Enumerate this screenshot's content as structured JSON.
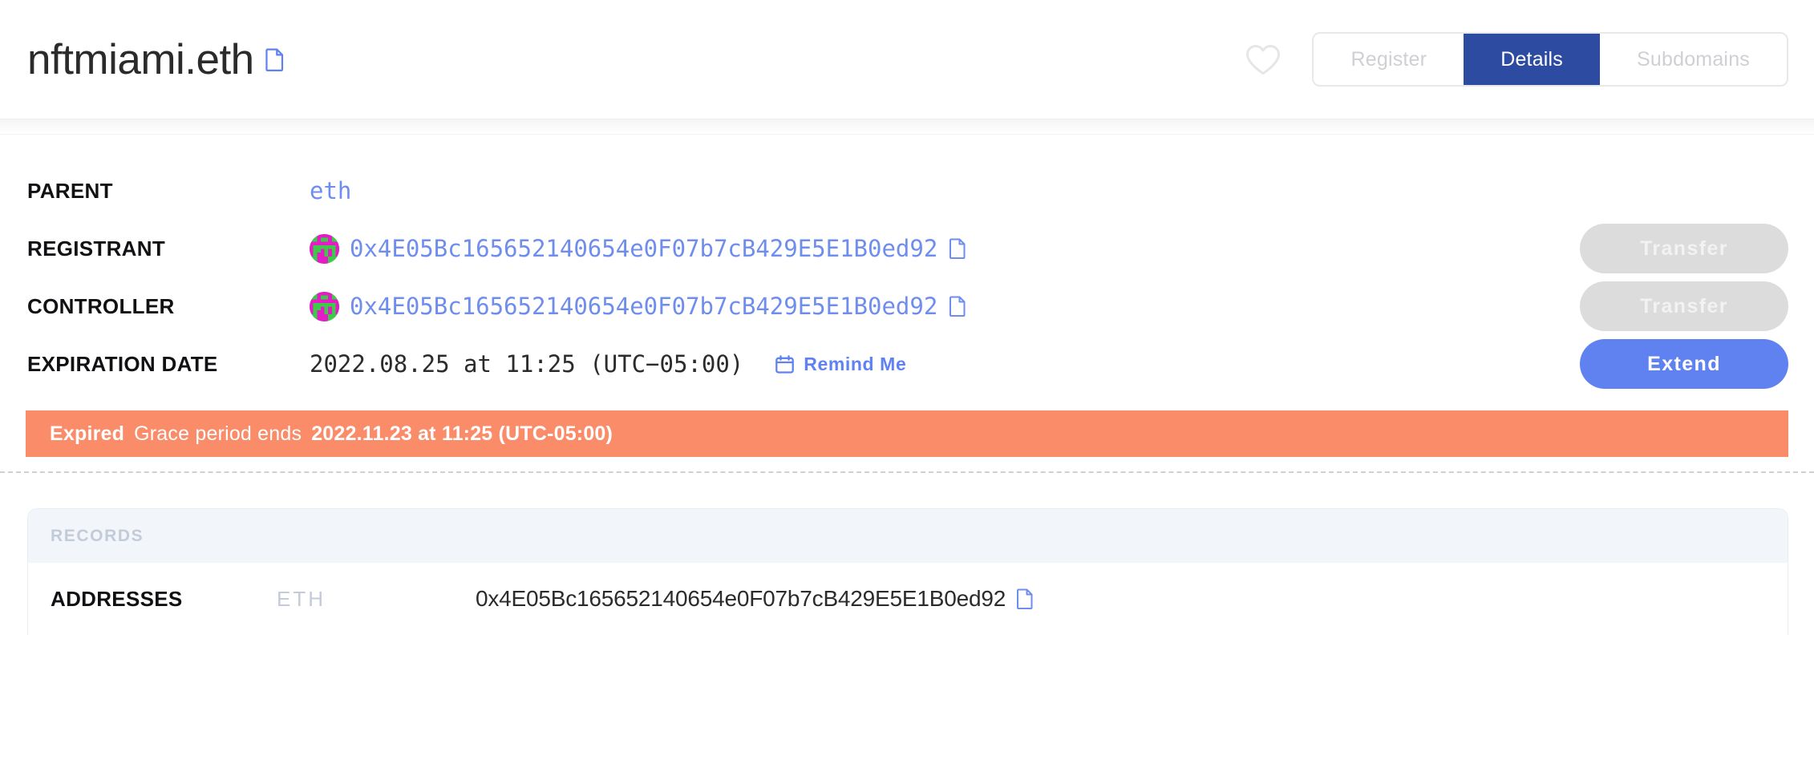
{
  "header": {
    "domain_title": "nftmiami.eth",
    "copy_icon": "copy-document-icon",
    "favorite_icon": "heart-icon",
    "tabs": [
      {
        "label": "Register",
        "active": false
      },
      {
        "label": "Details",
        "active": true
      },
      {
        "label": "Subdomains",
        "active": false
      }
    ]
  },
  "details": {
    "rows": [
      {
        "label": "PARENT",
        "value": "eth",
        "has_avatar": false,
        "has_copy": false,
        "action": null
      },
      {
        "label": "REGISTRANT",
        "value": "0x4E05Bc165652140654e0F07b7cB429E5E1B0ed92",
        "has_avatar": true,
        "has_copy": true,
        "action": "Transfer"
      },
      {
        "label": "CONTROLLER",
        "value": "0x4E05Bc165652140654e0F07b7cB429E5E1B0ed92",
        "has_avatar": true,
        "has_copy": true,
        "action": "Transfer"
      },
      {
        "label": "EXPIRATION DATE",
        "value": "2022.08.25 at 11:25 (UTC−05:00)",
        "has_avatar": false,
        "has_copy": false,
        "action": "Extend"
      }
    ],
    "remind_label": "Remind Me",
    "remind_icon": "calendar-icon",
    "transfer_label": "Transfer",
    "extend_label": "Extend"
  },
  "banner": {
    "status": "Expired",
    "message": "Grace period ends",
    "grace_end": "2022.11.23 at 11:25 (UTC-05:00)",
    "color": "#fb8c69"
  },
  "records": {
    "section_title": "RECORDS",
    "rows": [
      {
        "label": "ADDRESSES",
        "type": "ETH",
        "value": "0x4E05Bc165652140654e0F07b7cB429E5E1B0ed92",
        "copy_icon": "copy-document-icon"
      }
    ]
  },
  "colors": {
    "accent_blue": "#5f82f0",
    "tab_active": "#2d4ba0",
    "mono_link": "#6f8ded",
    "banner": "#fb8c69",
    "disabled": "#dcdcdc",
    "records_header_bg": "#f2f6fb"
  }
}
